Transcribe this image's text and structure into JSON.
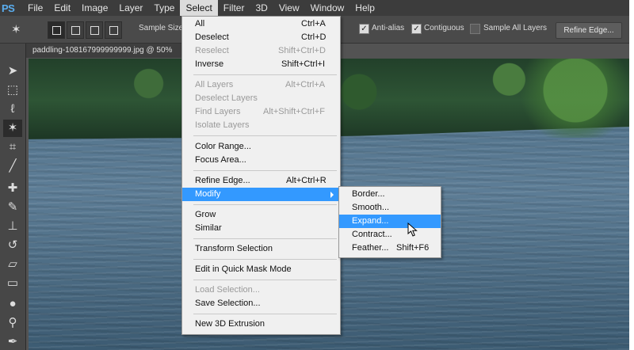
{
  "app": {
    "logo": "PS"
  },
  "menubar": {
    "items": [
      "File",
      "Edit",
      "Image",
      "Layer",
      "Type",
      "Select",
      "Filter",
      "3D",
      "View",
      "Window",
      "Help"
    ],
    "active": "Select"
  },
  "options": {
    "tool_icon": "magic-wand-icon",
    "sample_size_label": "Sample Size",
    "anti_alias": {
      "label": "Anti-alias",
      "checked": true
    },
    "contiguous": {
      "label": "Contiguous",
      "checked": true
    },
    "sample_all_layers": {
      "label": "Sample All Layers",
      "checked": false
    },
    "refine_edge_button": "Refine Edge..."
  },
  "document": {
    "tab_title": "paddling-108167999999999.jpg @ 50%"
  },
  "toolbar": {
    "tools": [
      "move-icon",
      "marquee-icon",
      "lasso-icon",
      "magic-wand-icon",
      "crop-icon",
      "eyedropper-icon",
      "healing-brush-icon",
      "brush-icon",
      "clone-stamp-icon",
      "history-brush-icon",
      "eraser-icon",
      "gradient-icon",
      "blur-icon",
      "dodge-icon",
      "pen-icon"
    ],
    "selected": "magic-wand-icon"
  },
  "select_menu": {
    "items": [
      {
        "label": "All",
        "shortcut": "Ctrl+A",
        "disabled": false
      },
      {
        "label": "Deselect",
        "shortcut": "Ctrl+D",
        "disabled": false
      },
      {
        "label": "Reselect",
        "shortcut": "Shift+Ctrl+D",
        "disabled": true
      },
      {
        "label": "Inverse",
        "shortcut": "Shift+Ctrl+I",
        "disabled": false
      },
      {
        "label": "All Layers",
        "shortcut": "Alt+Ctrl+A",
        "disabled": true
      },
      {
        "label": "Deselect Layers",
        "shortcut": "",
        "disabled": true
      },
      {
        "label": "Find Layers",
        "shortcut": "Alt+Shift+Ctrl+F",
        "disabled": true
      },
      {
        "label": "Isolate Layers",
        "shortcut": "",
        "disabled": true
      },
      {
        "label": "Color Range...",
        "shortcut": "",
        "disabled": false
      },
      {
        "label": "Focus Area...",
        "shortcut": "",
        "disabled": false
      },
      {
        "label": "Refine Edge...",
        "shortcut": "Alt+Ctrl+R",
        "disabled": false
      },
      {
        "label": "Modify",
        "shortcut": "",
        "disabled": false,
        "highlighted": true,
        "submenu": true
      },
      {
        "label": "Grow",
        "shortcut": "",
        "disabled": false
      },
      {
        "label": "Similar",
        "shortcut": "",
        "disabled": false
      },
      {
        "label": "Transform Selection",
        "shortcut": "",
        "disabled": false
      },
      {
        "label": "Edit in Quick Mask Mode",
        "shortcut": "",
        "disabled": false
      },
      {
        "label": "Load Selection...",
        "shortcut": "",
        "disabled": true
      },
      {
        "label": "Save Selection...",
        "shortcut": "",
        "disabled": false
      },
      {
        "label": "New 3D Extrusion",
        "shortcut": "",
        "disabled": false
      }
    ]
  },
  "modify_submenu": {
    "items": [
      {
        "label": "Border...",
        "shortcut": ""
      },
      {
        "label": "Smooth...",
        "shortcut": ""
      },
      {
        "label": "Expand...",
        "shortcut": "",
        "highlighted": true
      },
      {
        "label": "Contract...",
        "shortcut": ""
      },
      {
        "label": "Feather...",
        "shortcut": "Shift+F6"
      }
    ]
  }
}
